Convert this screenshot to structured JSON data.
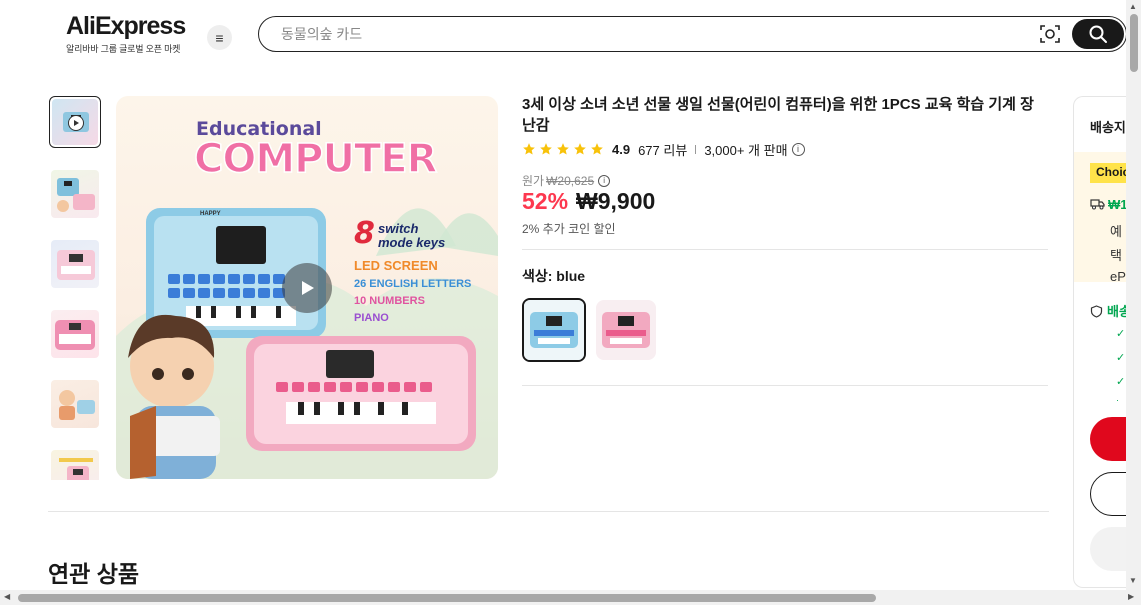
{
  "header": {
    "logo": "AliExpress",
    "logo_sub": "알리바바 그룹 글로벌 오픈 마켓",
    "search_placeholder": "동물의숲 카드"
  },
  "main_image": {
    "brand_top": "Educational",
    "brand_bottom": "COMPUTER",
    "feature_number": "8",
    "feature_switch": "switch",
    "feature_mode": "mode keys",
    "features": [
      "LED SCREEN",
      "26 ENGLISH LETTERS",
      "10 NUMBERS",
      "PIANO"
    ],
    "device_label": "HAPPY"
  },
  "product": {
    "title": "3세 이상 소녀 소년 선물 생일 선물(어린이 컴퓨터)을 위한 1PCS 교육 학습 기계 장난감",
    "rating": "4.9",
    "stars": 5,
    "reviews": "677 리뷰",
    "sold": "3,000+ 개 판매",
    "orig_label": "원가",
    "orig_price": "₩20,625",
    "discount": "52%",
    "price": "₩9,900",
    "coin_discount": "2% 추가 코인 할인",
    "color_label": "색상: blue",
    "colors": [
      "blue",
      "pink"
    ]
  },
  "related_title": "연관 상품",
  "side_panel": {
    "ship_title": "배송지",
    "choice_tag": "Choice",
    "ship_price": "₩1",
    "line1": "예",
    "line2": "택",
    "line3": "eP",
    "green_label": "배송"
  },
  "colors": {
    "accent_red": "#fd384f",
    "buy_red": "#e0081d",
    "choice_yellow": "#ffe34a",
    "green": "#00a650"
  }
}
